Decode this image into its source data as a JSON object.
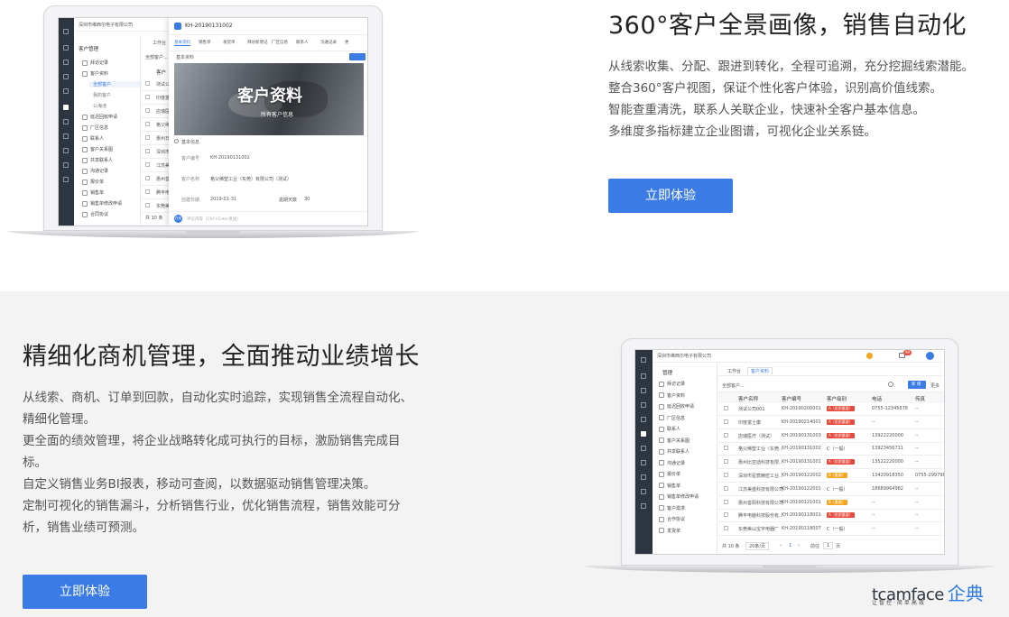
{
  "feature1": {
    "title": "360°客户全景画像，销售自动化",
    "lines": [
      "从线索收集、分配、跟进到转化，全程可追溯，充分挖掘线索潜能。",
      "整合360°客户视图，保证个性化客户体验，识别高价值线索。",
      "智能查重清洗，联系人关联企业，快速补全客户基本信息。",
      "多维度多指标建立企业图谱，可视化企业关系链。"
    ],
    "cta": "立即体验"
  },
  "feature2": {
    "title": "精细化商机管理，全面推动业绩增长",
    "lines": [
      "从线索、商机、订单到回款，自动化实时追踪，实现销售全流程自动化、",
      "精细化管理。",
      "更全面的绩效管理，将企业战略转化成可执行的目标，激励销售完成目",
      "标。",
      "自定义销售业务BI报表，移动可查阅，以数据驱动销售管理决策。",
      "定制可视化的销售漏斗，分析销售行业，优化销售流程，销售效能可分",
      "析，销售业绩可预测。"
    ],
    "cta": "立即体验"
  },
  "mock1": {
    "company": "深圳市维西尔电子有限公司",
    "section": "客户管理",
    "menu": [
      "拜访记录",
      "客户资料",
      "全部客户",
      "我的客户",
      "公海池",
      "延迟回收申请",
      "厂区信息",
      "联系人",
      "客户关系图",
      "共享联系人",
      "沟通记录",
      "报价单",
      "销售单",
      "销售单修改申请",
      "合同协议"
    ],
    "tab_workbench": "工作台",
    "list_header": "全部客户...",
    "list_col": "客户",
    "list_rows": [
      "测试公",
      "印度富",
      "店瑞医",
      "格父稀",
      "惠州日",
      "深圳市",
      "江苏美",
      "惠州善",
      "腾丰电",
      "东莞美"
    ],
    "footer": "共 10 条",
    "record_id": "KH-20190131002",
    "detail_tabs": [
      "基本资料",
      "销售单",
      "发货单",
      "拜访新增记",
      "厂区信息",
      "联系人",
      "沟通记录",
      "更"
    ],
    "detail_sub": "基本资料",
    "edit": "编辑",
    "banner_title": "客户资料",
    "banner_sub": "所有客户信息",
    "info_section": "基本信息",
    "fields": [
      {
        "label": "客户编号",
        "value": "KH-20190131002"
      },
      {
        "label": "客户名称",
        "value": "格父稀塑工业（东莞）有限公司（测试）"
      },
      {
        "label": "创建日期",
        "value": "2019-01-31"
      }
    ],
    "extra_label": "逾期天数",
    "extra_value": "30",
    "comment_placeholder": "评论内容（Ctrl+Enter发送）",
    "avatar": "在线"
  },
  "mock2": {
    "company": "深圳市维西尔电子有限公司",
    "menu": [
      "拜访记录",
      "客户资料",
      "延迟回收申请",
      "厂区信息",
      "联系人",
      "客户关系图",
      "共享联系人",
      "沟通记录",
      "报价单",
      "销售单",
      "销售单修改申请",
      "客户需求",
      "合作协议",
      "发货单"
    ],
    "section": "管理",
    "tabs": [
      "工作台",
      "客户资料"
    ],
    "list_header": "全部客户...",
    "btn_new": "新 增",
    "btn_more": "更多",
    "columns": [
      "客户名称",
      "客户编号",
      "客户级别",
      "电话",
      "传真"
    ],
    "rows": [
      {
        "name": "测试公司001",
        "code": "KH-20190200001",
        "level": "A（优质重要）",
        "color": "red",
        "phone": "0755-12345678",
        "fax": "--"
      },
      {
        "name": "印度富士康",
        "code": "KH-20190214001",
        "level": "A（优质重要）",
        "color": "red",
        "phone": "--",
        "fax": "--"
      },
      {
        "name": "店瑞医疗（测试）",
        "code": "KH-20190131003",
        "level": "A（优质重要）",
        "color": "red",
        "phone": "13922220000",
        "fax": "--"
      },
      {
        "name": "格父稀塑工业（东莞...",
        "code": "KH-20190131002",
        "level": "C（一般）",
        "color": "none",
        "phone": "13923456711",
        "fax": "--"
      },
      {
        "name": "惠州比亚迪科技有限...",
        "code": "KH-20190131001",
        "level": "A（优质重要）",
        "color": "red",
        "phone": "13522220000",
        "fax": "--"
      },
      {
        "name": "深圳市星宸精密工业...",
        "code": "KH-20190122002",
        "level": "B（重要）",
        "color": "orange",
        "phone": "13420918350",
        "fax": "0755-29979880"
      },
      {
        "name": "江苏美盛科技有限公司",
        "code": "KH-20190122001",
        "level": "C（一般）",
        "color": "none",
        "phone": "18689964982",
        "fax": "--"
      },
      {
        "name": "惠州善阳科技有限公司",
        "code": "KH-20190121001",
        "level": "B（重要）",
        "color": "orange",
        "phone": "--",
        "fax": "--"
      },
      {
        "name": "腾丰电脑科技股份有...",
        "code": "KH-20190118001",
        "level": "A（优质重要）",
        "color": "red",
        "phone": "--",
        "fax": "--"
      },
      {
        "name": "东莞美山宝宇电器厂",
        "code": "KH-20190118007",
        "level": "C（一般）",
        "color": "none",
        "phone": "--",
        "fax": "--"
      }
    ],
    "footer": "共 10 条",
    "page_size": "20条/页",
    "page_num": "1",
    "goto_label": "前往",
    "goto_page": "1",
    "page_suffix": "页",
    "notif_count": "99"
  },
  "logo": {
    "en": "tcamface",
    "cn": "企典",
    "sub": "让智控·简单高效"
  }
}
